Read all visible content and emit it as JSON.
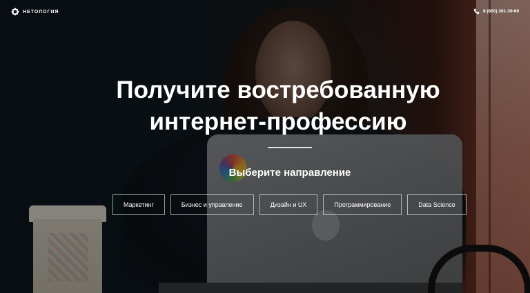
{
  "header": {
    "logo_text": "НЕТОЛОГИЯ",
    "phone": "8 (800) 301-39-69"
  },
  "hero": {
    "headline_line1": "Получите востребованную",
    "headline_line2": "интернет-профессию",
    "subheading": "Выберите направление",
    "categories": [
      {
        "label": "Маркетинг"
      },
      {
        "label": "Бизнес и управление"
      },
      {
        "label": "Дизайн и UX"
      },
      {
        "label": "Программирование"
      },
      {
        "label": "Data Science"
      }
    ]
  },
  "icons": {
    "logo": "netology-flower-icon",
    "phone": "phone-icon"
  },
  "colors": {
    "text": "#ffffff",
    "button_border": "rgba(255,255,255,0.6)",
    "overlay": "rgba(0,0,0,0.42)"
  }
}
